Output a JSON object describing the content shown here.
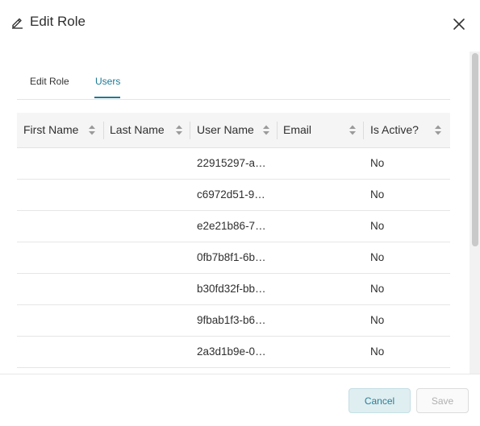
{
  "dialog": {
    "title": "Edit Role",
    "title_icon": "pencil-icon",
    "close_icon": "close-icon"
  },
  "tabs": [
    {
      "label": "Edit Role",
      "active": false
    },
    {
      "label": "Users",
      "active": true
    }
  ],
  "table": {
    "columns": [
      "First Name",
      "Last Name",
      "User Name",
      "Email",
      "Is Active?"
    ],
    "rows": [
      {
        "first_name": "",
        "last_name": "",
        "user_name": "22915297-a…",
        "email": "",
        "is_active": "No"
      },
      {
        "first_name": "",
        "last_name": "",
        "user_name": "c6972d51-9…",
        "email": "",
        "is_active": "No"
      },
      {
        "first_name": "",
        "last_name": "",
        "user_name": "e2e21b86-7…",
        "email": "",
        "is_active": "No"
      },
      {
        "first_name": "",
        "last_name": "",
        "user_name": "0fb7b8f1-6b…",
        "email": "",
        "is_active": "No"
      },
      {
        "first_name": "",
        "last_name": "",
        "user_name": "b30fd32f-bb…",
        "email": "",
        "is_active": "No"
      },
      {
        "first_name": "",
        "last_name": "",
        "user_name": "9fbab1f3-b6…",
        "email": "",
        "is_active": "No"
      },
      {
        "first_name": "",
        "last_name": "",
        "user_name": "2a3d1b9e-0…",
        "email": "",
        "is_active": "No"
      }
    ]
  },
  "footer": {
    "cancel_label": "Cancel",
    "save_label": "Save"
  },
  "colors": {
    "accent": "#1a7a96",
    "cancel_bg": "#dfeef1",
    "header_bg": "#f5f5f5"
  }
}
